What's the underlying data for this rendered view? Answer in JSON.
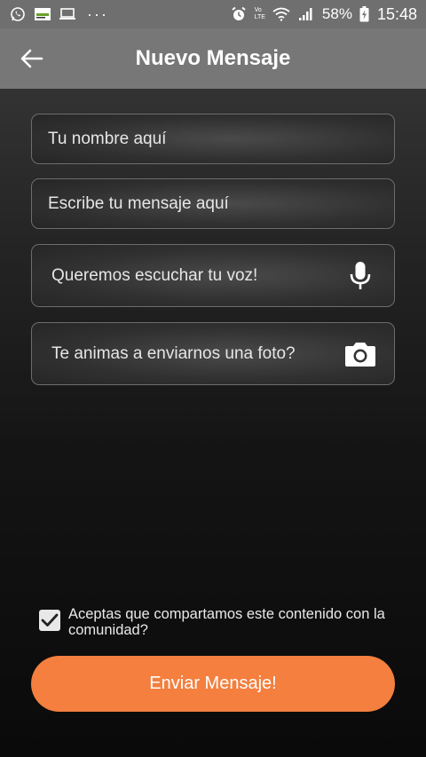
{
  "status_bar": {
    "battery_percent": "58%",
    "time": "15:48",
    "notification_icons": [
      "whatsapp-icon",
      "news-icon",
      "laptop-icon"
    ],
    "more_indicator": "···",
    "network_label_top": "Vo",
    "network_label_bottom": "LTE"
  },
  "app_bar": {
    "title": "Nuevo Mensaje"
  },
  "form": {
    "name_placeholder": "Tu nombre aquí",
    "message_placeholder": "Escribe tu mensaje aquí",
    "voice_placeholder": "Queremos escuchar tu voz!",
    "photo_placeholder": "Te animas a enviarnos una foto?",
    "consent_text": "Aceptas que compartamos este contenido con la comunidad?",
    "consent_checked": true,
    "submit_label": "Enviar Mensaje!"
  },
  "colors": {
    "accent": "#f47f3e",
    "app_bar": "#777777",
    "status_bar": "#6f6f6f"
  }
}
